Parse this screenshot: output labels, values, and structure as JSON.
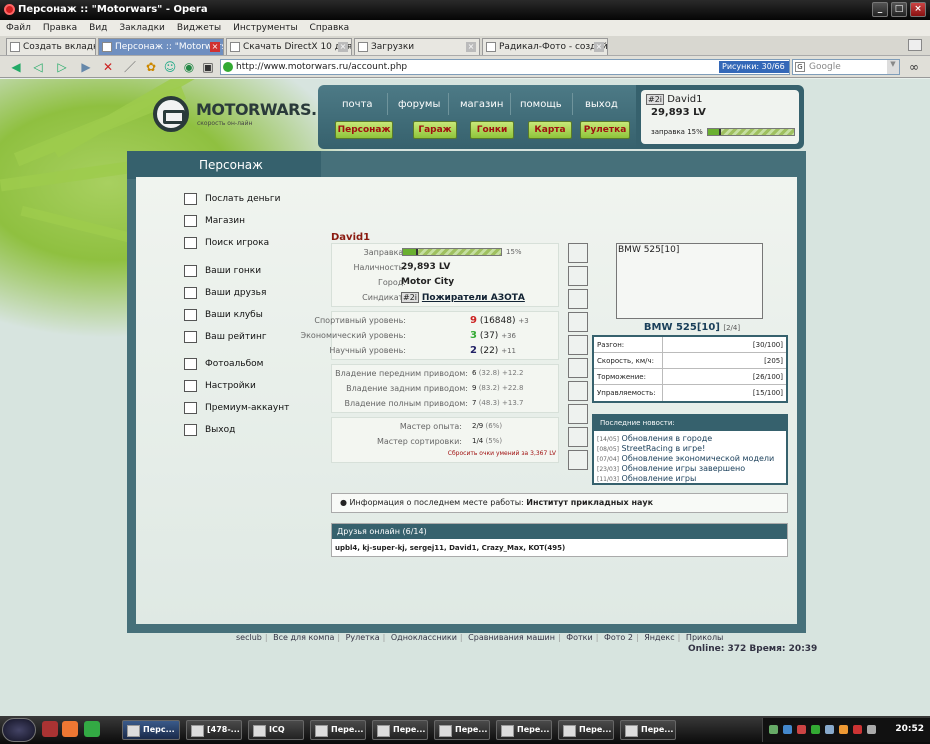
{
  "window": {
    "title": "Персонаж :: \"Motorwars\" - Opera",
    "buttons": [
      "_",
      "□",
      "×"
    ]
  },
  "menubar": [
    "Файл",
    "Правка",
    "Вид",
    "Закладки",
    "Виджеты",
    "Инструменты",
    "Справка"
  ],
  "tabs": [
    {
      "label": "Создать вкладку"
    },
    {
      "label": "Персонаж :: \"Motorwars\""
    },
    {
      "label": "Скачать DirectX 10 для ..."
    },
    {
      "label": "Загрузки"
    },
    {
      "label": "Радикал-Фото - создай..."
    }
  ],
  "address": {
    "url": "http://www.motorwars.ru/account.php",
    "images_label": "Рисунки: 30/66",
    "search_placeholder": "Google",
    "search_logo": "G"
  },
  "toolbar_icons": [
    "back-icon",
    "rewind-icon",
    "forward-icon",
    "fast-forward-icon",
    "stop-icon",
    "edit-icon",
    "puzzle-icon",
    "accessibility-icon",
    "globe-icon",
    "save-icon",
    "film-icon"
  ],
  "site": {
    "logo_name": "MOTORWARS.RU",
    "logo_sub": "скорость он-лайн",
    "topnav": [
      "почта",
      "форумы",
      "магазин",
      "помощь",
      "выход"
    ],
    "greenbtns": [
      "Персонаж",
      "Гараж",
      "Гонки",
      "Карта",
      "Рулетка"
    ],
    "user": {
      "tag": "#2i",
      "name": "David1",
      "money": "29,893 LV",
      "fuel_label": "заправка 15%",
      "fuel": 0.15
    }
  },
  "panel": {
    "title": "Персонаж",
    "menu": [
      "Послать деньги",
      "Магазин",
      "Поиск игрока",
      "Ваши гонки",
      "Ваши друзья",
      "Ваши клубы",
      "Ваш рейтинг",
      "Фотоальбом",
      "Настройки",
      "Премиум-аккаунт",
      "Выход"
    ],
    "username": "David1",
    "fuel_label": "Заправка:",
    "fuel_pct": "15%",
    "fuel": 0.15,
    "cash_label": "Наличность:",
    "cash": "29,893 LV",
    "city_label": "Город:",
    "city": "Motor City",
    "synd_label": "Синдикат:",
    "synd_tag": "#2i",
    "synd": "Пожиратели АЗОТА",
    "levels": [
      {
        "label": "Спортивный уровень:",
        "value": "9",
        "extra": "(16848)",
        "plus": "+3"
      },
      {
        "label": "Экономический уровень:",
        "value": "3",
        "extra": "(37)",
        "plus": "+36"
      },
      {
        "label": "Научный уровень:",
        "value": "2",
        "extra": "(22)",
        "plus": "+11"
      }
    ],
    "drives": [
      {
        "label": "Владение передним приводом:",
        "value": "6",
        "extra": "(32.8)",
        "plus": "+12.2"
      },
      {
        "label": "Владение задним приводом:",
        "value": "9",
        "extra": "(83.2)",
        "plus": "+22.8"
      },
      {
        "label": "Владение полным приводом:",
        "value": "7",
        "extra": "(48.3)",
        "plus": "+13.7"
      }
    ],
    "masters": [
      {
        "label": "Мастер опыта:",
        "value": "2/9",
        "extra": "(6%)"
      },
      {
        "label": "Мастер сортировки:",
        "value": "1/4",
        "extra": "(5%)"
      }
    ],
    "reset": "Сбросить очки умений за 3,367 LV",
    "car_caption": "BMW 525[10]",
    "car_name": "BMW 525[10]",
    "car_count": "[2/4]",
    "car_stats": [
      {
        "k": "Разгон:",
        "v": "[30/100]"
      },
      {
        "k": "Скорость, км/ч:",
        "v": "[205]"
      },
      {
        "k": "Торможение:",
        "v": "[26/100]"
      },
      {
        "k": "Управляемость:",
        "v": "[15/100]"
      }
    ],
    "news_title": "Последние новости:",
    "news": [
      {
        "d": "[14/05]",
        "t": "Обновления в городе"
      },
      {
        "d": "[08/05]",
        "t": "StreetRacing в игре!"
      },
      {
        "d": "[07/04]",
        "t": "Обновление экономической модели"
      },
      {
        "d": "[23/03]",
        "t": "Обновление игры завершено"
      },
      {
        "d": "[11/03]",
        "t": "Обновление игры"
      }
    ],
    "work_label": "Информация о последнем месте работы:",
    "work": "Институт прикладных наук",
    "friends_title": "Друзья онлайн (6/14)",
    "friends": "upbl4, kj-super-kj, sergej11, David1, Crazy_Max, KOT(495)"
  },
  "footer": {
    "links": [
      "seclub",
      "Все для компа",
      "Рулетка",
      "Одноклассники",
      "Сравнивания машин",
      "Фотки",
      "Фото 2",
      "Яндекс",
      "Приколы"
    ],
    "online": "Online: 372  Время: 20:39"
  },
  "taskbar": {
    "items": [
      "Перс...",
      "[478-...",
      "ICQ",
      "Пере...",
      "Пере...",
      "Пере...",
      "Пере...",
      "Пере...",
      "Пере..."
    ],
    "clock": "20:52"
  }
}
